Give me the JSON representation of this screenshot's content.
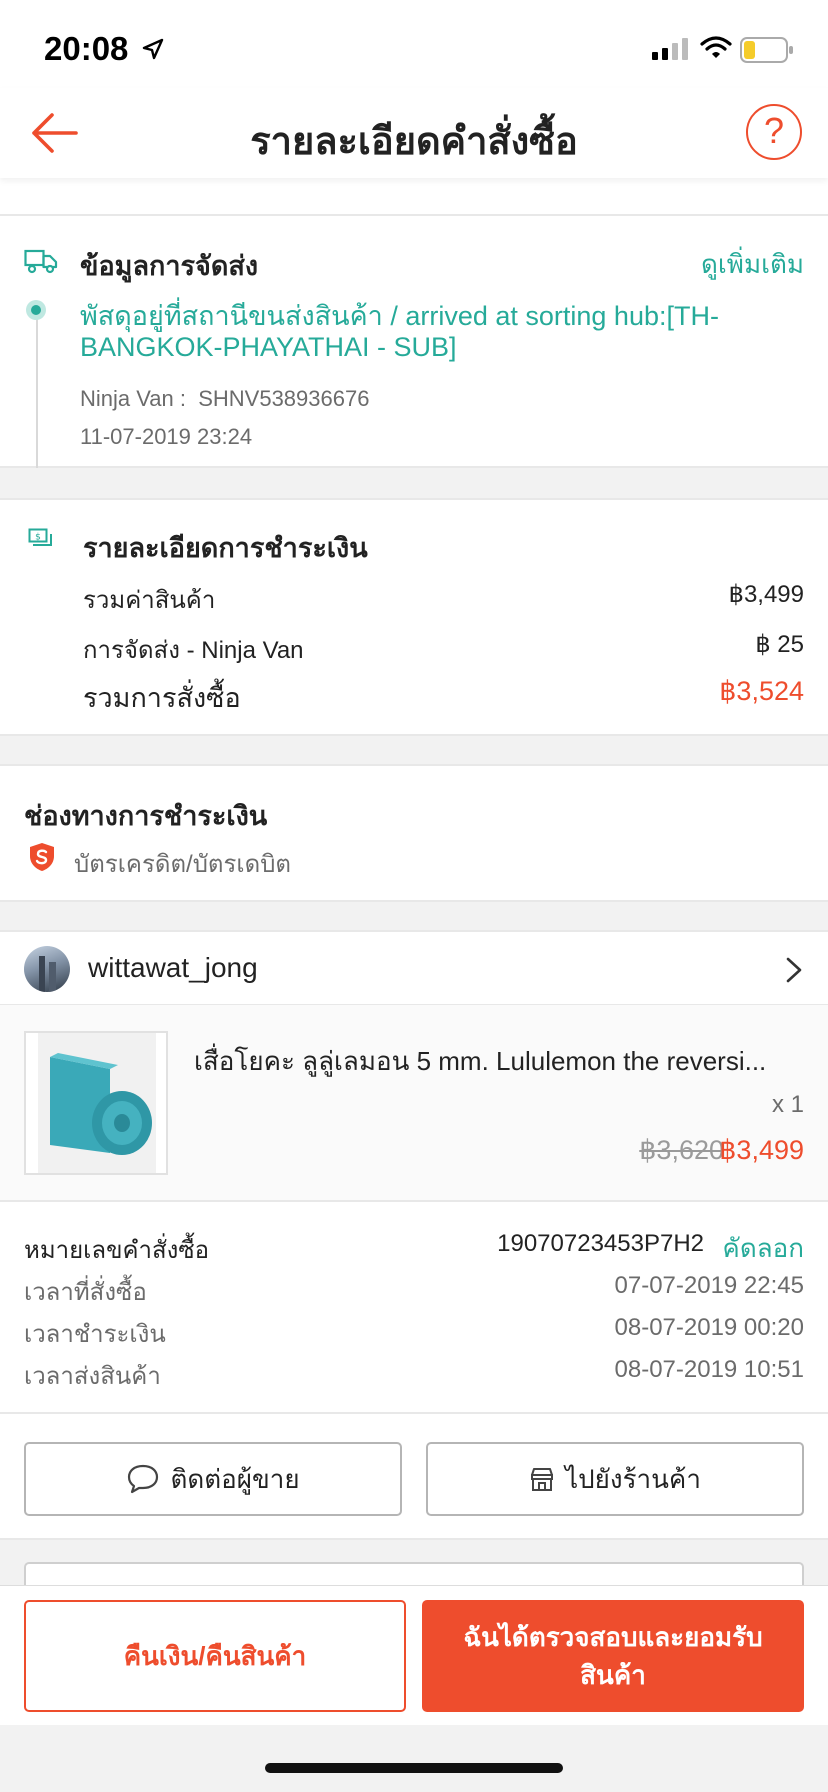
{
  "status_bar": {
    "time": "20:08"
  },
  "nav": {
    "title": "รายละเอียดคำสั่งซื้อ",
    "help_glyph": "?"
  },
  "shipping": {
    "title": "ข้อมูลการจัดส่ง",
    "see_more": "ดูเพิ่มเติม",
    "status_line1": "พัสดุอยู่ที่สถานีขนส่งสินค้า / arrived at sorting hub:[TH-",
    "status_line2": "BANGKOK-PHAYATHAI - SUB]",
    "carrier": "Ninja Van :  SHNV538936676",
    "timestamp": "11-07-2019 23:24"
  },
  "payment_details": {
    "title": "รายละเอียดการชำระเงิน",
    "rows": [
      {
        "label": "รวมค่าสินค้า",
        "value": "฿3,499"
      },
      {
        "label": "การจัดส่ง - Ninja Van",
        "value": "฿ 25"
      }
    ],
    "total_label": "รวมการสั่งซื้อ",
    "total_value": "฿3,524"
  },
  "payment_method": {
    "title": "ช่องทางการชำระเงิน",
    "value": "บัตรเครดิต/บัตรเดบิต"
  },
  "seller": {
    "name": "wittawat_jong"
  },
  "product": {
    "name": "เสื่อโยคะ ลูลู่เลมอน 5 mm. Lululemon the reversi...",
    "quantity": "x 1",
    "original_price": "฿3,620",
    "price": "฿3,499"
  },
  "order_info": {
    "order_number_label": "หมายเลขคำสั่งซื้อ",
    "order_number": "19070723453P7H2",
    "copy_label": "คัดลอก",
    "rows": [
      {
        "label": "เวลาที่สั่งซื้อ",
        "value": "07-07-2019 22:45"
      },
      {
        "label": "เวลาชำระเงิน",
        "value": "08-07-2019 00:20"
      },
      {
        "label": "เวลาส่งสินค้า",
        "value": "08-07-2019 10:51"
      }
    ]
  },
  "actions": {
    "contact_seller": "ติดต่อผู้ขาย",
    "go_to_shop": "ไปยังร้านค้า"
  },
  "bottom": {
    "refund": "คืนเงิน/คืนสินค้า",
    "accept_line1": "ฉันได้ตรวจสอบและยอมรับ",
    "accept_line2": "สินค้า"
  },
  "colors": {
    "accent": "#ee4d2d",
    "teal": "#26aa99"
  }
}
